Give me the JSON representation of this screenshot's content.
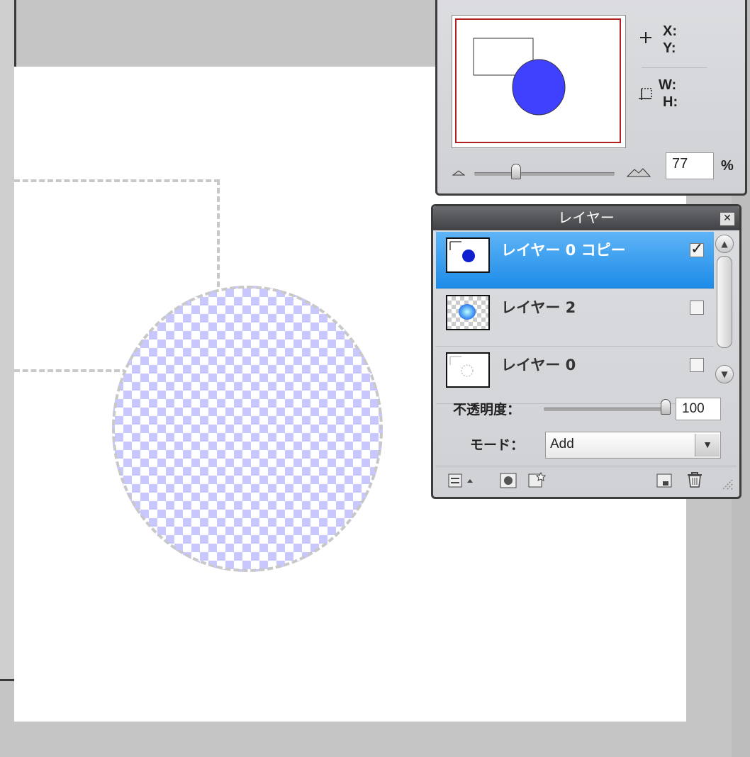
{
  "navigator": {
    "x_label": "X:",
    "y_label": "Y:",
    "w_label": "W:",
    "h_label": "H:",
    "zoom_value": "77",
    "zoom_unit": "%",
    "zoom_slider_fraction": 0.3
  },
  "layers_panel": {
    "title": "レイヤー",
    "close_glyph": "✕",
    "layers": [
      {
        "name": "レイヤー 0 コピー",
        "visible": true,
        "selected": true
      },
      {
        "name": "レイヤー 2",
        "visible": false,
        "selected": false
      },
      {
        "name": "レイヤー 0",
        "visible": false,
        "selected": false
      }
    ],
    "opacity_label": "不透明度：",
    "opacity_value": "100",
    "mode_label": "モード：",
    "mode_value": "Add",
    "check_glyph": "✓",
    "scroll_up_glyph": "▲",
    "scroll_down_glyph": "▼",
    "dropdown_glyph": "▼"
  },
  "colors": {
    "selection_accent": "#1c8be8",
    "shape_fill": "#4040ff",
    "checker_tint": "#c8c8ff"
  }
}
